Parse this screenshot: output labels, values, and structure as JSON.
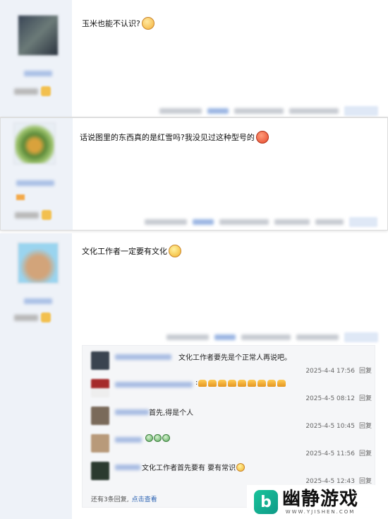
{
  "posts": [
    {
      "content": "玉米也能不认识?",
      "emoji": "laugh-emoji"
    },
    {
      "content": "话说图里的东西真的是红雪吗?我没见过这种型号的",
      "emoji": "angry-emoji"
    },
    {
      "content": "文化工作者一定要有文化",
      "emoji": "grin-emoji"
    }
  ],
  "sub_replies": [
    {
      "text": "文化工作者要先是个正常人再说吧。",
      "time": "2025-4-4 17:56",
      "reply": "回复"
    },
    {
      "text": ":",
      "time": "2025-4-5 08:12",
      "reply": "回复"
    },
    {
      "text": "首先,得是个人",
      "time": "2025-4-5 10:45",
      "reply": "回复"
    },
    {
      "text": "",
      "time": "2025-4-5 11:56",
      "reply": "回复"
    },
    {
      "text": "文化工作者首先要有 要有常识",
      "time": "2025-4-5 12:43",
      "reply": "回复"
    }
  ],
  "more": {
    "text": "还有3条回复,",
    "link": "点击查看"
  },
  "watermark": {
    "title": "幽静游戏",
    "url": "WWW.YJISHEN.COM",
    "logo": "b"
  }
}
